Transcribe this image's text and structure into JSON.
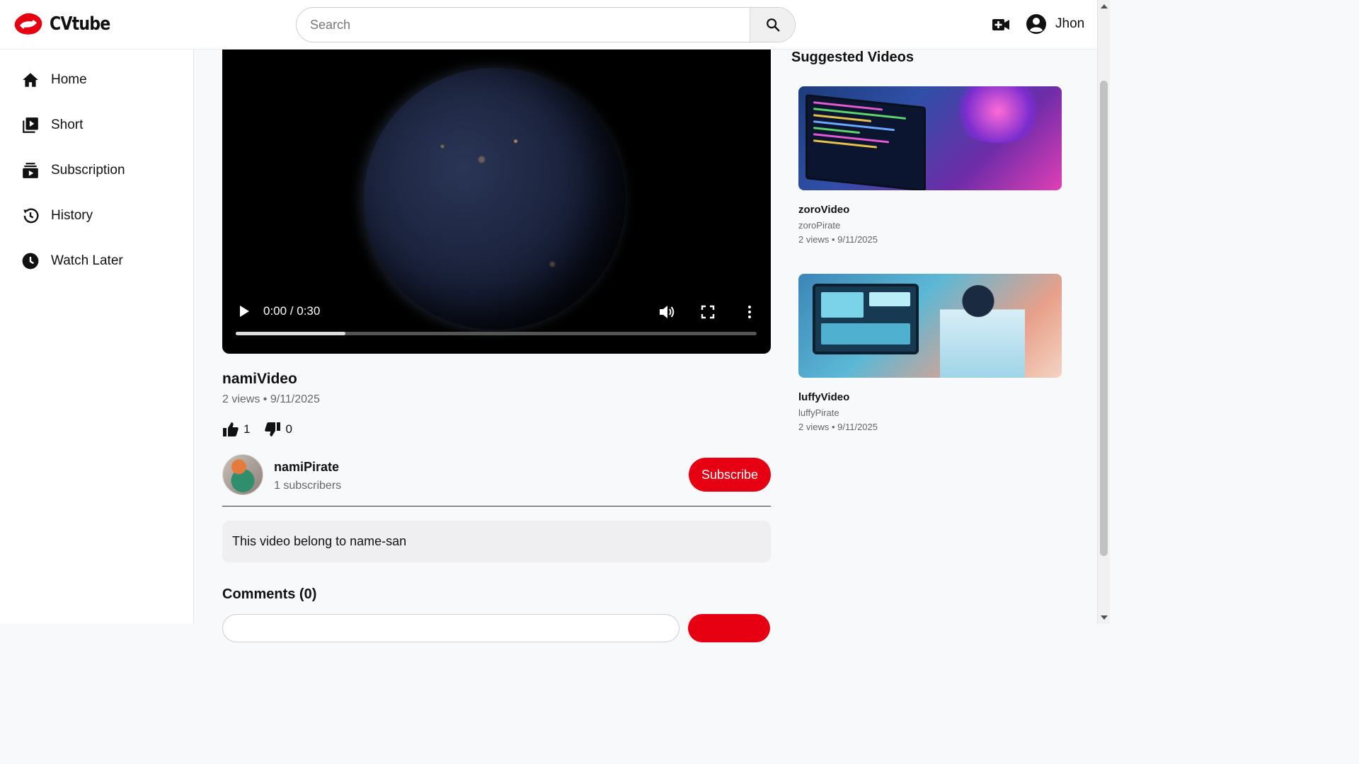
{
  "app": {
    "name": "CVtube",
    "brand_color": "#e60012"
  },
  "search": {
    "placeholder": "Search"
  },
  "user": {
    "name": "Jhon"
  },
  "sidebar": {
    "items": [
      {
        "label": "Home",
        "icon": "home-icon"
      },
      {
        "label": "Short",
        "icon": "shorts-icon"
      },
      {
        "label": "Subscription",
        "icon": "subscriptions-icon"
      },
      {
        "label": "History",
        "icon": "history-icon"
      },
      {
        "label": "Watch Later",
        "icon": "clock-icon"
      }
    ]
  },
  "player": {
    "time": "0:00 / 0:30",
    "progress": 0.21
  },
  "video": {
    "title": "namiVideo",
    "meta": "2 views • 9/11/2025",
    "likes": "1",
    "dislikes": "0",
    "description": "This video belong to name-san"
  },
  "channel": {
    "name": "namiPirate",
    "subscribers": "1 subscribers",
    "subscribe_label": "Subscribe"
  },
  "comments": {
    "title": "Comments (0)"
  },
  "suggested": {
    "title": "Suggested Videos",
    "videos": [
      {
        "title": "zoroVideo",
        "channel": "zoroPirate",
        "meta": "2 views • 9/11/2025"
      },
      {
        "title": "luffyVideo",
        "channel": "luffyPirate",
        "meta": "2 views • 9/11/2025"
      }
    ]
  }
}
